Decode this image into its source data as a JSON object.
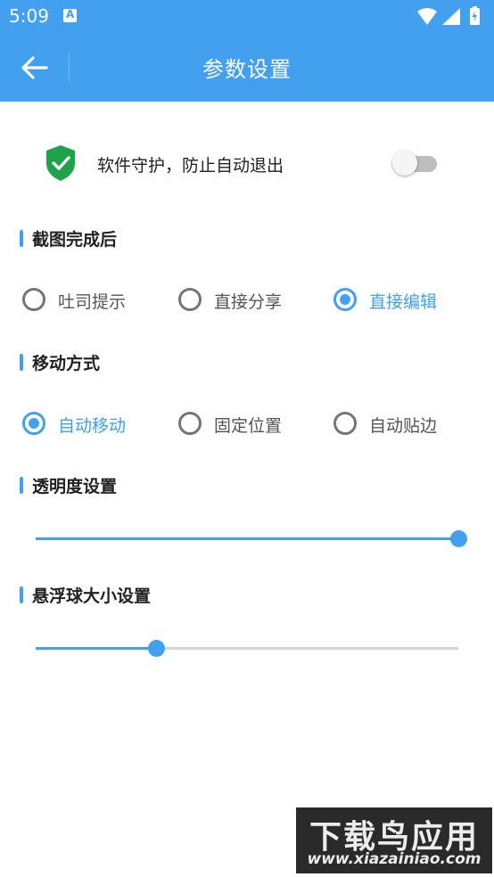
{
  "status_bar": {
    "time": "5:09",
    "notification_icon": "a-letter-icon",
    "icons": [
      "wifi-icon",
      "signal-icon",
      "battery-charging-icon"
    ]
  },
  "app_bar": {
    "title": "参数设置",
    "back_icon": "arrow-left-icon"
  },
  "guard": {
    "label": "软件守护，防止自动退出",
    "enabled": false,
    "icon": "shield-check-icon"
  },
  "sections": {
    "screenshot_after": {
      "title": "截图完成后",
      "options": [
        "吐司提示",
        "直接分享",
        "直接编辑"
      ],
      "selected_index": 2
    },
    "move_mode": {
      "title": "移动方式",
      "options": [
        "自动移动",
        "固定位置",
        "自动贴边"
      ],
      "selected_index": 0
    },
    "transparency": {
      "title": "透明度设置",
      "value_fraction": 1.0
    },
    "ball_size": {
      "title": "悬浮球大小设置",
      "value_fraction": 0.285
    }
  },
  "watermark": {
    "title": "下载鸟应用",
    "url": "www.xiazainiao.com"
  },
  "colors": {
    "accent": "#42a0ee",
    "shield": "#1fa34a"
  }
}
